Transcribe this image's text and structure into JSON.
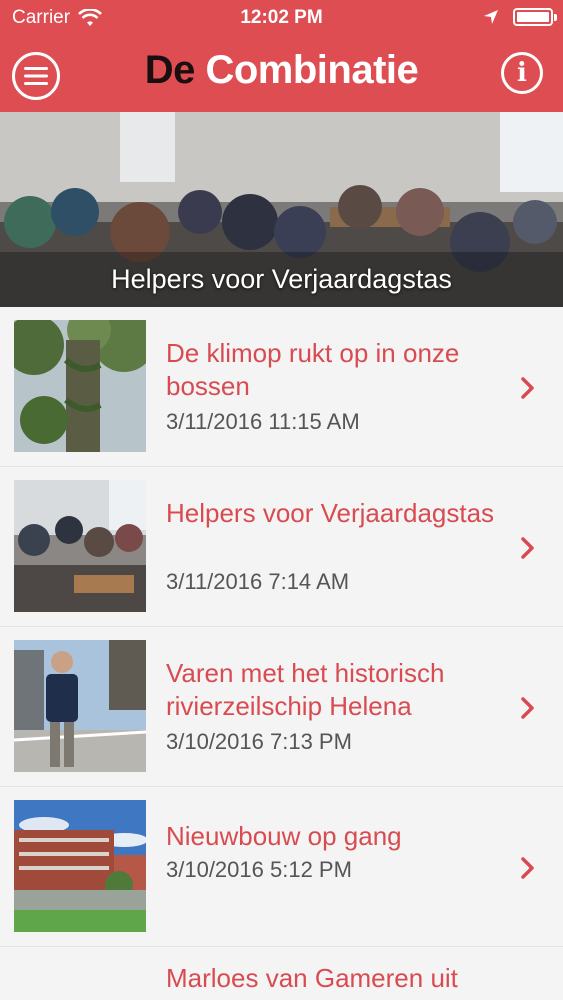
{
  "status": {
    "carrier": "Carrier",
    "time": "12:02 PM"
  },
  "header": {
    "logo_part1": "De",
    "logo_part2": "Combinatie",
    "info_glyph": "i",
    "menu_icon": "hamburger-icon",
    "info_icon": "info-icon"
  },
  "hero": {
    "caption": "Helpers voor Verjaardagstas"
  },
  "articles": [
    {
      "title": "De klimop rukt op in onze bossen",
      "date": "3/11/2016 11:15 AM"
    },
    {
      "title": "Helpers voor Verjaardagstas",
      "date": "3/11/2016 7:14 AM"
    },
    {
      "title": "Varen met het historisch rivierzeilschip Helena",
      "date": "3/10/2016 7:13 PM"
    },
    {
      "title": "Nieuwbouw op gang",
      "date": "3/10/2016 5:12 PM"
    },
    {
      "title": "Marloes van Gameren uit",
      "date": ""
    }
  ],
  "colors": {
    "brand": "#dd4d52",
    "title": "#d84c51",
    "background": "#f4f4f4"
  }
}
